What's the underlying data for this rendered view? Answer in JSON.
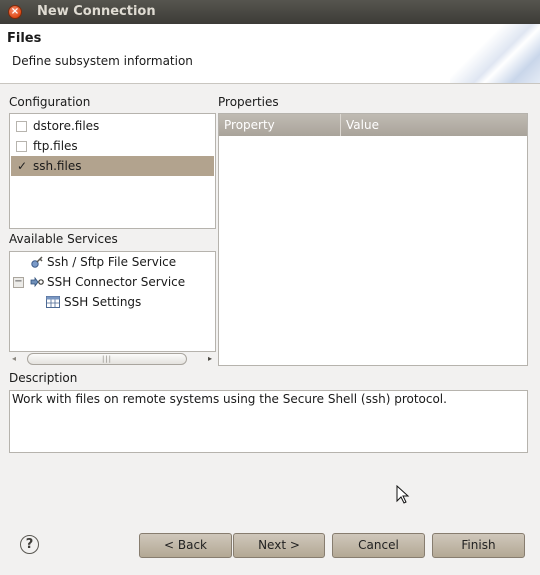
{
  "window": {
    "title": "New Connection",
    "close_glyph": "×"
  },
  "header": {
    "title": "Files",
    "description": "Define subsystem information"
  },
  "configuration": {
    "label": "Configuration",
    "items": [
      {
        "label": "dstore.files",
        "checked": false,
        "check_glyph": ""
      },
      {
        "label": "ftp.files",
        "checked": false,
        "check_glyph": ""
      },
      {
        "label": "ssh.files",
        "checked": true,
        "check_glyph": "✓"
      }
    ],
    "selected_index": 2
  },
  "available_services": {
    "label": "Available Services",
    "tree": [
      {
        "label": "Ssh / Sftp File Service",
        "icon": "file-service-icon"
      },
      {
        "label": "SSH Connector Service",
        "icon": "connector-service-icon",
        "expander": "−",
        "expanded": true
      },
      {
        "label": "SSH Settings",
        "icon": "settings-table-icon"
      }
    ],
    "scrollbar": {
      "left_arrow": "◂",
      "right_arrow": "▸",
      "grip": "|||"
    }
  },
  "properties": {
    "label": "Properties",
    "columns": [
      "Property",
      "Value"
    ],
    "rows": []
  },
  "description": {
    "label": "Description",
    "text": "Work with files on remote systems using the Secure Shell (ssh) protocol."
  },
  "buttons": {
    "help": "?",
    "back": "< Back",
    "next": "Next >",
    "cancel": "Cancel",
    "finish": "Finish"
  },
  "colors": {
    "titlebar": "#3c3b37",
    "selection": "#b2a38e",
    "button": "#c2b9ab"
  }
}
